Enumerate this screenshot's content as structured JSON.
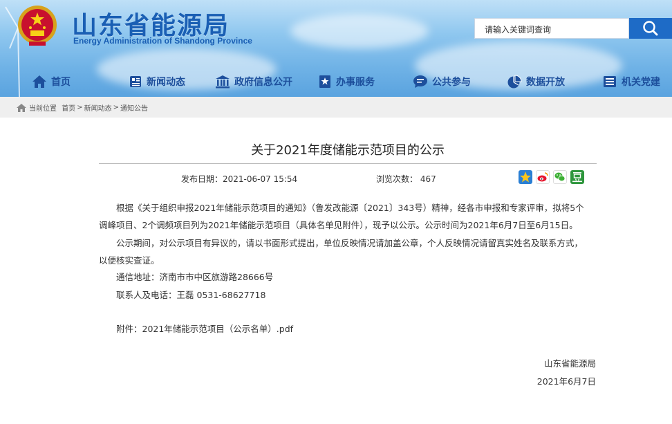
{
  "site": {
    "title_cn": "山东省能源局",
    "title_en": "Energy Administration of Shandong Province"
  },
  "search": {
    "placeholder": "请输入关键词查询",
    "icon": "search-icon"
  },
  "nav": {
    "items": [
      {
        "label": "首页",
        "icon": "home-icon"
      },
      {
        "label": "新闻动态",
        "icon": "news-icon"
      },
      {
        "label": "政府信息公开",
        "icon": "government-building-icon"
      },
      {
        "label": "办事服务",
        "icon": "service-icon"
      },
      {
        "label": "公共参与",
        "icon": "chat-icon"
      },
      {
        "label": "数据开放",
        "icon": "pie-chart-icon"
      },
      {
        "label": "机关党建",
        "icon": "party-building-icon"
      }
    ]
  },
  "breadcrumb": {
    "prefix": "当前位置",
    "items": [
      "首页",
      "新闻动态",
      "通知公告"
    ],
    "separator": ">"
  },
  "article": {
    "title": "关于2021年度储能示范项目的公示",
    "publish_label": "发布日期：2021-06-07 15:54",
    "views_label": "浏览次数：",
    "views_count": "467",
    "share_icons": [
      "qzone-icon",
      "weibo-icon",
      "wechat-icon",
      "douban-icon"
    ],
    "para1_line1": "根据《关于组织申报2021年储能示范项目的通知》（鲁发改能源〔2021〕343号）精神，经各市申报和专家评审，拟将5个",
    "para1_line2": "调峰项目、2个调频项目列为2021年储能示范项目（具体名单见附件），现予以公示。公示时间为2021年6月7日至6月15日。",
    "para2_line1": "公示期间，对公示项目有异议的，请以书面形式提出，单位反映情况请加盖公章，个人反映情况请留真实姓名及联系方式，",
    "para2_line2": "以便核实查证。",
    "address": "通信地址：济南市市中区旅游路28666号",
    "contact": "联系人及电话：王磊  0531-68627718",
    "attachment": "附件：2021年储能示范项目（公示名单）.pdf",
    "signature_org": "山东省能源局",
    "signature_date": "2021年6月7日"
  },
  "colors": {
    "brand_blue": "#1a5fb4",
    "nav_text": "#1d4f9c",
    "search_button": "#1e6bc6"
  }
}
